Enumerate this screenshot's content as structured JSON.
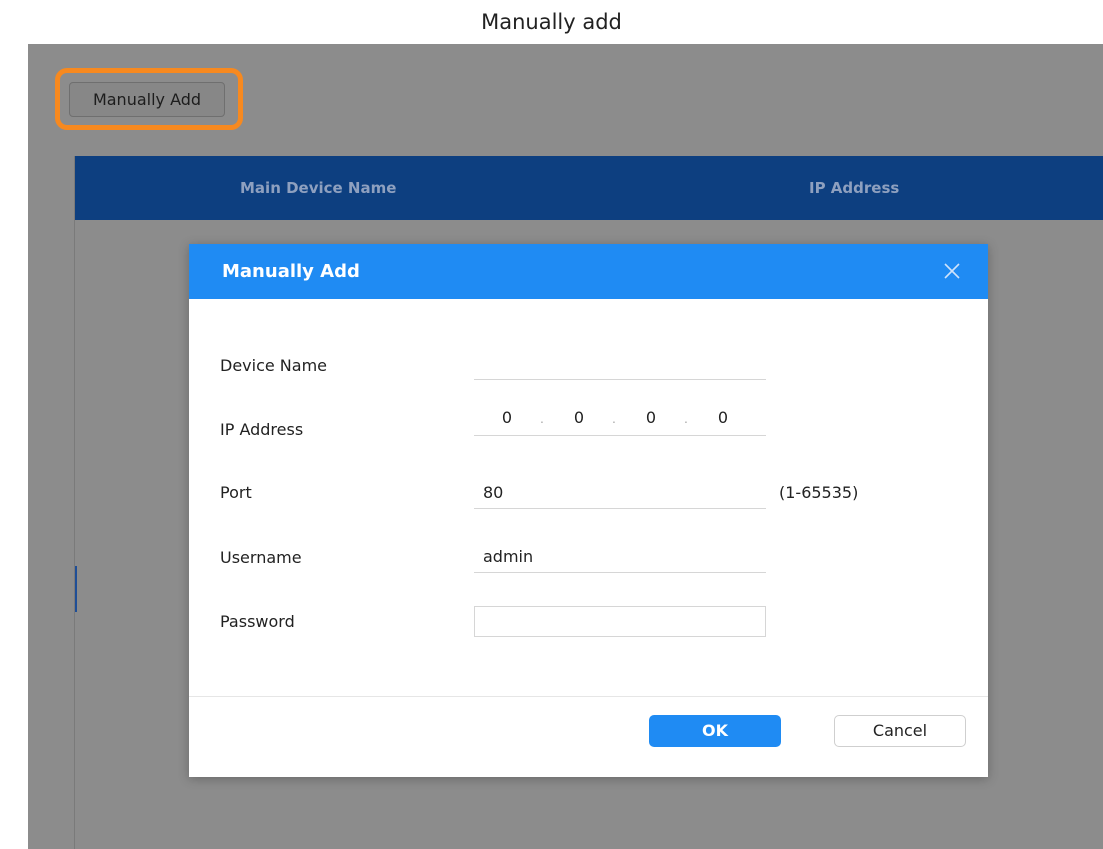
{
  "caption": "Manually add",
  "toolbar": {
    "manually_add_label": "Manually Add"
  },
  "table": {
    "columns": [
      "Main Device Name",
      "IP Address"
    ]
  },
  "dialog": {
    "title": "Manually Add",
    "close_icon": "close-icon",
    "fields": {
      "device_name": {
        "label": "Device Name",
        "value": ""
      },
      "ip_address": {
        "label": "IP Address",
        "segments": [
          "0",
          "0",
          "0",
          "0"
        ]
      },
      "port": {
        "label": "Port",
        "value": "80",
        "hint": "(1-65535)"
      },
      "username": {
        "label": "Username",
        "value": "admin"
      },
      "password": {
        "label": "Password",
        "value": ""
      }
    },
    "ok_label": "OK",
    "cancel_label": "Cancel"
  },
  "colors": {
    "highlight": "#f7891f",
    "dialog_header": "#1f8bf3",
    "table_header": "#0d3f80",
    "overlay": "#8c8c8c"
  }
}
